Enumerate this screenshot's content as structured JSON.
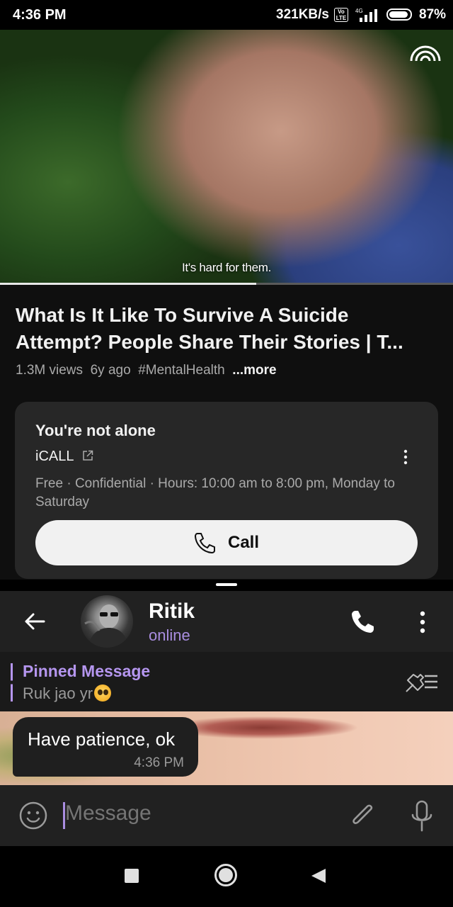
{
  "status_bar": {
    "time": "4:36 PM",
    "network_speed": "321KB/s",
    "volte_label": "Vo LTE",
    "signal_label": "4G",
    "battery_percent": "87%"
  },
  "video": {
    "caption": "It's hard for them.",
    "progress": 0.565,
    "title": "What Is It Like To Survive A Suicide Attempt? People Share Their Stories | T...",
    "views": "1.3M views",
    "age": "6y ago",
    "hashtag": "#MentalHealth",
    "more_label": "...more"
  },
  "crisis_card": {
    "heading": "You're not alone",
    "org": "iCALL",
    "description": "Free · Confidential · Hours: 10:00 am to 8:00 pm, Monday to Saturday",
    "call_label": "Call"
  },
  "chat": {
    "contact_name": "Ritik",
    "contact_status": "online",
    "pinned_title": "Pinned Message",
    "pinned_text": "Ruk jao yr",
    "messages": [
      {
        "text": "Have patience, ok",
        "time": "4:36 PM"
      }
    ],
    "input_placeholder": "Message"
  },
  "colors": {
    "accent": "#a98de0",
    "pinned_accent": "#b596ef",
    "youtube_bg": "#0f0f0f",
    "telegram_header": "#212121"
  },
  "icons": [
    "cast-icon",
    "external-link-icon",
    "more-vert-icon",
    "phone-icon",
    "back-arrow-icon",
    "unpin-icon",
    "smile-icon",
    "attach-icon",
    "mic-icon",
    "recents-icon",
    "home-icon",
    "nav-back-icon"
  ]
}
